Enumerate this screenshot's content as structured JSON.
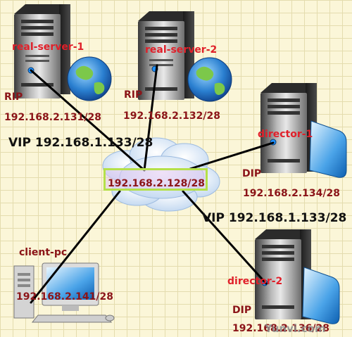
{
  "diagram": {
    "nodes": {
      "real_server_1": {
        "name": "real-server-1",
        "ip_type": "RIP",
        "ip": "192.168.2.131/28"
      },
      "real_server_2": {
        "name": "real-server-2",
        "ip_type": "RIP",
        "ip": "192.168.2.132/28"
      },
      "director_1": {
        "name": "director-1",
        "ip_type": "DIP",
        "ip": "192.168.2.134/28"
      },
      "director_2": {
        "name": "director-2",
        "ip_type": "DIP",
        "ip": "192.168.2.136/28"
      },
      "client_pc": {
        "name": "client-pc",
        "ip": "192.168.2.141/28"
      }
    },
    "network": {
      "label": "192.168.2.128/28"
    },
    "vip_labels": [
      "VIP 192.168.1.133/28",
      "VIP 192.168.1.133/28"
    ],
    "watermark": "Yunvi.com",
    "colors": {
      "background": "#fbf6d8",
      "node_name": "#e0202a",
      "ip_text": "#8b1418",
      "vip_text": "#111111",
      "link_line": "#000000",
      "network_border": "#b5e04a"
    }
  }
}
